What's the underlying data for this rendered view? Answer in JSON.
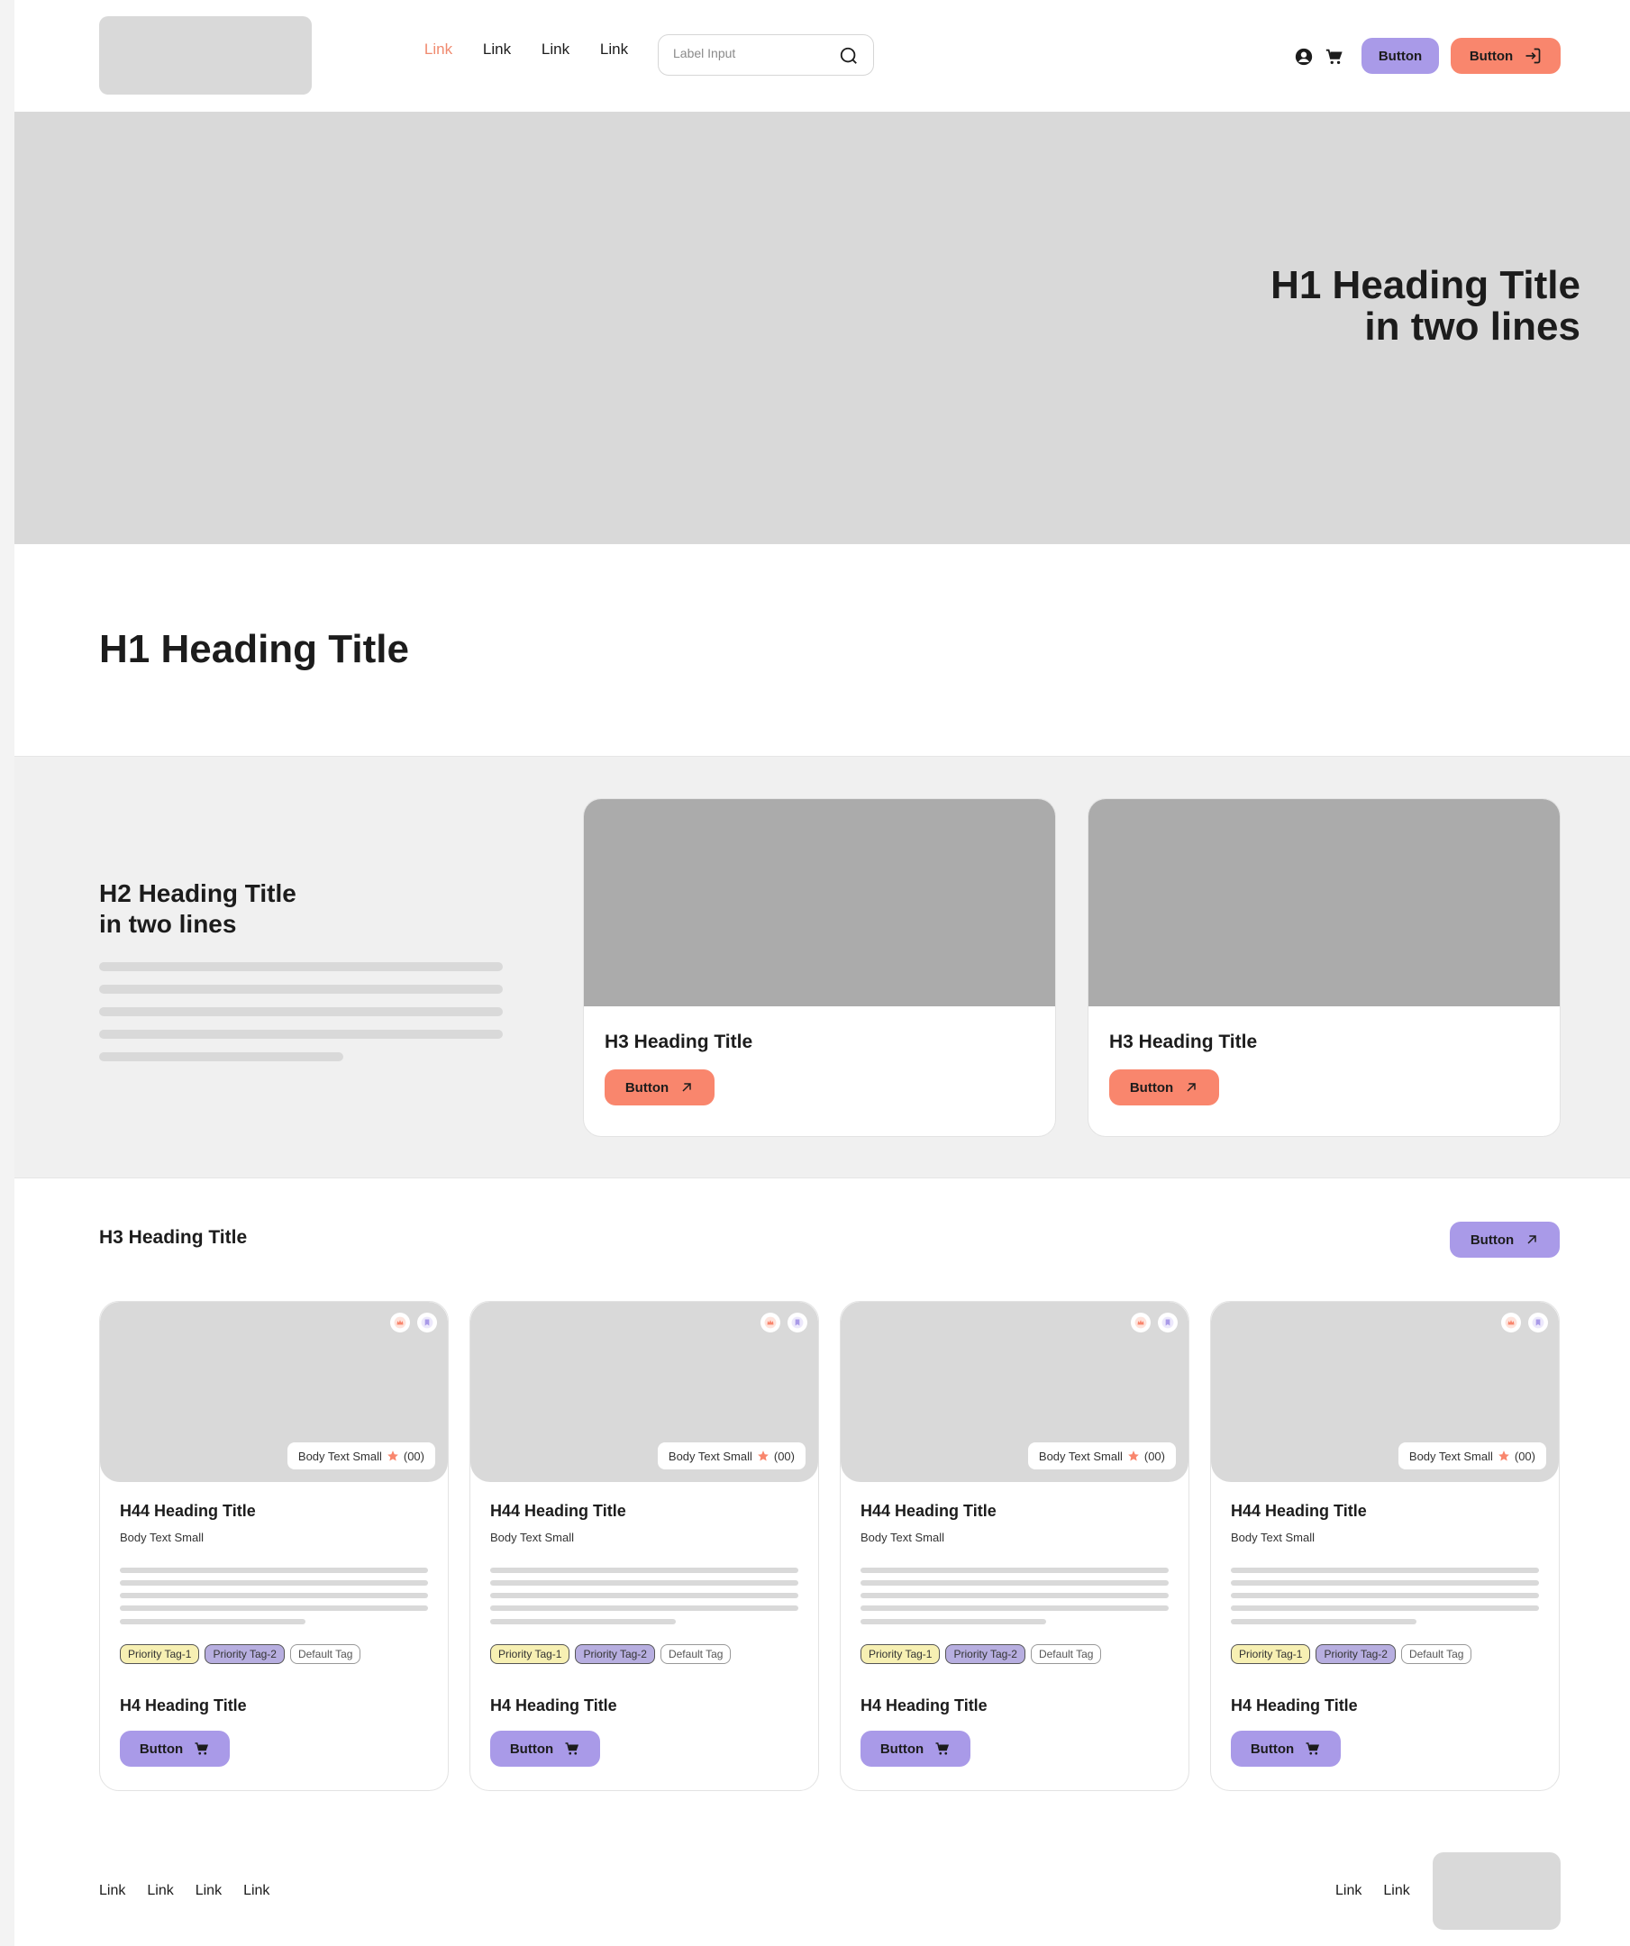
{
  "header": {
    "nav": [
      "Link",
      "Link",
      "Link",
      "Link"
    ],
    "active_nav_index": 0,
    "search_placeholder": "Label Input",
    "button_primary": "Button",
    "button_secondary": "Button",
    "icons": [
      "search-icon",
      "user-icon",
      "cart-icon",
      "login-icon"
    ]
  },
  "hero": {
    "title_line1": "H1 Heading Title",
    "title_line2": "in two lines"
  },
  "intro": {
    "title": "H1 Heading Title"
  },
  "feature": {
    "title_line1": "H2 Heading Title",
    "title_line2": "in two lines",
    "cards": [
      {
        "title": "H3 Heading Title",
        "button": "Button"
      },
      {
        "title": "H3 Heading Title",
        "button": "Button"
      }
    ]
  },
  "products": {
    "title": "H3 Heading Title",
    "button": "Button",
    "cards": [
      {
        "rating_label": "Body Text Small",
        "rating_count": "(00)",
        "title": "H44 Heading Title",
        "subtitle": "Body Text Small",
        "tags": [
          "Priority Tag-1",
          "Priority Tag-2",
          "Default Tag"
        ],
        "footer_title": "H4 Heading Title",
        "button": "Button"
      },
      {
        "rating_label": "Body Text Small",
        "rating_count": "(00)",
        "title": "H44 Heading Title",
        "subtitle": "Body Text Small",
        "tags": [
          "Priority Tag-1",
          "Priority Tag-2",
          "Default Tag"
        ],
        "footer_title": "H4 Heading Title",
        "button": "Button"
      },
      {
        "rating_label": "Body Text Small",
        "rating_count": "(00)",
        "title": "H44 Heading Title",
        "subtitle": "Body Text Small",
        "tags": [
          "Priority Tag-1",
          "Priority Tag-2",
          "Default Tag"
        ],
        "footer_title": "H4 Heading Title",
        "button": "Button"
      },
      {
        "rating_label": "Body Text Small",
        "rating_count": "(00)",
        "title": "H44 Heading Title",
        "subtitle": "Body Text Small",
        "tags": [
          "Priority Tag-1",
          "Priority Tag-2",
          "Default Tag"
        ],
        "footer_title": "H4 Heading Title",
        "button": "Button"
      }
    ]
  },
  "footer": {
    "links_left": [
      "Link",
      "Link",
      "Link",
      "Link"
    ],
    "links_right": [
      "Link",
      "Link"
    ]
  },
  "colors": {
    "accent_orange": "#f9866d",
    "accent_purple": "#a99ae8",
    "placeholder_gray": "#d9d9d9",
    "tag_yellow": "#f7f0b3",
    "tag_violet": "#b7aee0"
  }
}
